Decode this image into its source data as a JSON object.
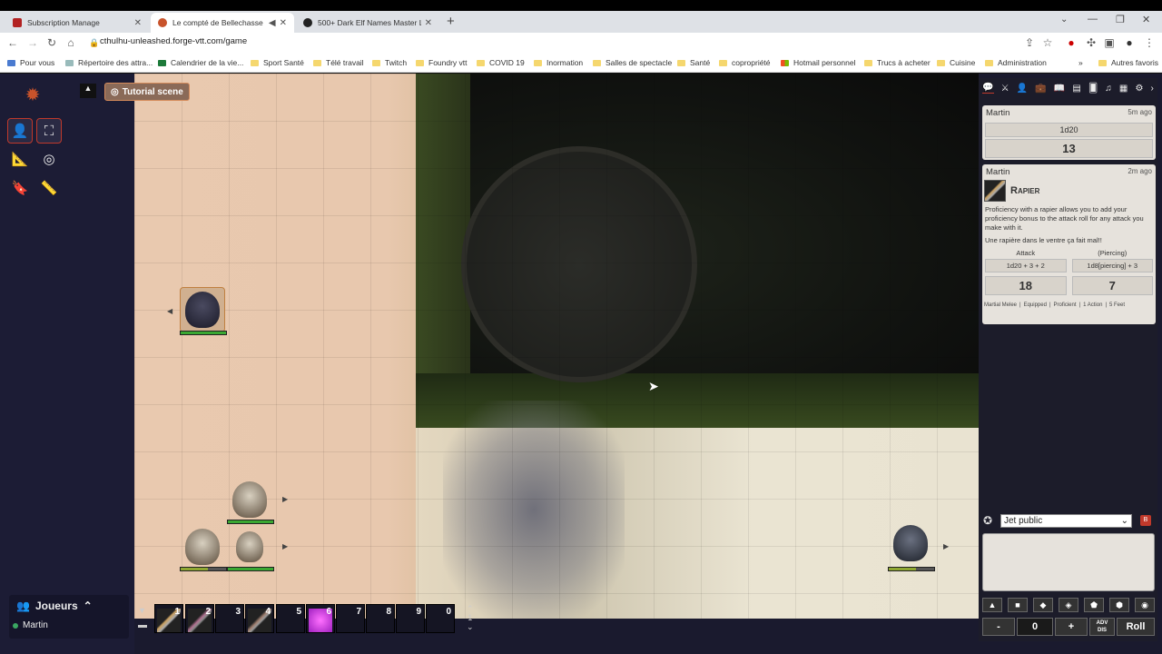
{
  "browser": {
    "tabs": [
      {
        "title": "Subscription Manage",
        "favicon_color": "#b22222"
      },
      {
        "title": "Le compté de Bellechasse • F",
        "favicon_color": "#c8532b"
      },
      {
        "title": "500+ Dark Elf Names Master List",
        "favicon_color": "#222222"
      }
    ],
    "url": "cthulhu-unleashed.forge-vtt.com/game",
    "bookmarks": [
      "Pour vous",
      "Répertoire des attra...",
      "Calendrier de la vie...",
      "Sport Santé",
      "Télé travail",
      "Twitch",
      "Foundry vtt",
      "COVID 19",
      "Inormation",
      "Salles de spectacle",
      "Santé",
      "copropriété",
      "Hotmail personnel",
      "Trucs à acheter",
      "Cuisine",
      "Administration"
    ],
    "bookmarks_more": "»",
    "other_bookmarks": "Autres favoris"
  },
  "vtt": {
    "scene_button": "Tutorial scene",
    "players_label": "Joueurs",
    "player_name": "Martin",
    "hotbar": [
      "1",
      "2",
      "3",
      "4",
      "5",
      "6",
      "7",
      "8",
      "9",
      "0"
    ],
    "hotbar_page": "1"
  },
  "chat": {
    "msg1": {
      "author": "Martin",
      "time": "5m ago",
      "formula": "1d20",
      "result": "13"
    },
    "msg2": {
      "author": "Martin",
      "time": "2m ago",
      "item": "Rapier",
      "desc": "Proficiency with a rapier allows you to add your proficiency bonus to the attack roll for any attack you make with it.",
      "note": "Une rapière dans le ventre ça fait mal!!",
      "attack_label": "Attack",
      "damage_label": "(Piercing)",
      "attack_formula": "1d20 + 3 + 2",
      "damage_formula": "1d8[piercing] + 3",
      "attack_result": "18",
      "damage_result": "7",
      "tags": [
        "Martial Melee",
        "Equipped",
        "Proficient",
        "1 Action",
        "5 Feet"
      ]
    },
    "roll_mode": "Jet public",
    "minus": "-",
    "zero": "0",
    "plus": "+",
    "adv": "ADV",
    "dis": "DIS",
    "roll": "Roll"
  }
}
